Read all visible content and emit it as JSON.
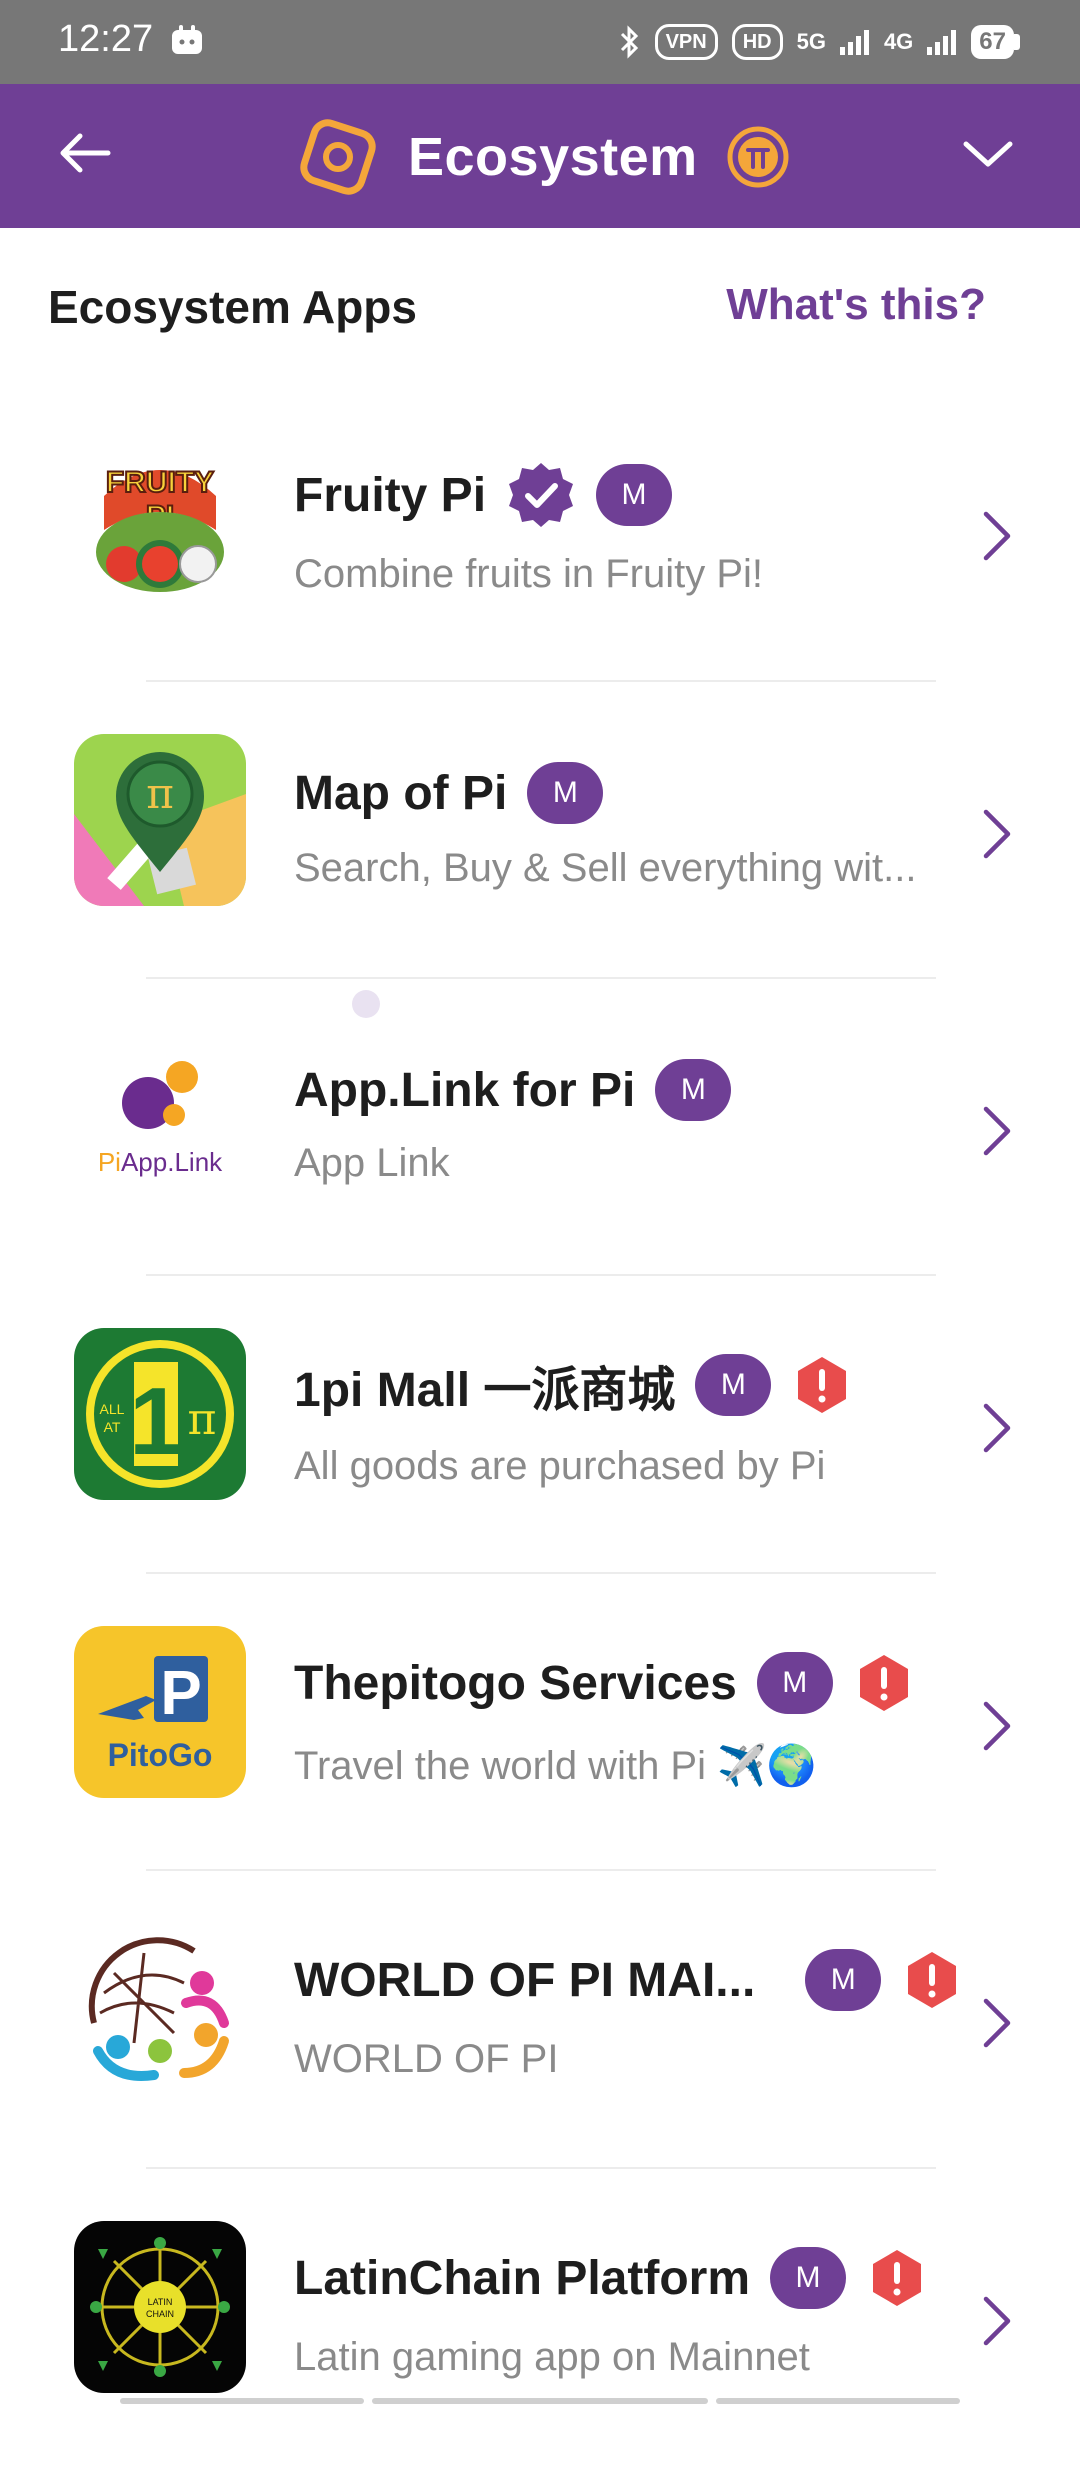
{
  "status": {
    "time": "12:27",
    "vpn": "VPN",
    "hd": "HD",
    "net1": "5G",
    "net2": "4G",
    "battery": "67"
  },
  "header": {
    "title": "Ecosystem",
    "accent": "#6f3f95"
  },
  "section": {
    "title": "Ecosystem Apps",
    "link": "What's this?"
  },
  "badge_label": "M",
  "apps": [
    {
      "name": "Fruity Pi",
      "desc": "Combine fruits in Fruity Pi!",
      "verified": true,
      "alert": false,
      "icon_text": "FRUITY PI"
    },
    {
      "name": "Map of Pi",
      "desc": "Search, Buy & Sell everything wit...",
      "verified": false,
      "alert": false
    },
    {
      "name": "App.Link for Pi",
      "desc": "App Link",
      "verified": false,
      "alert": false,
      "icon_text_pi": "Pi",
      "icon_text_link": "App.Link"
    },
    {
      "name": "1pi Mall 一派商城",
      "desc": "All goods are purchased by Pi",
      "verified": false,
      "alert": true,
      "icon_text_small": "ALL AT",
      "icon_text_big": "1"
    },
    {
      "name": "Thepitogo Services",
      "desc": "Travel the world with Pi ✈️🌍",
      "verified": false,
      "alert": true,
      "icon_text": "PitoGo"
    },
    {
      "name": "WORLD OF PI MAI...",
      "desc": "WORLD OF PI",
      "verified": false,
      "alert": true
    },
    {
      "name": "LatinChain Platform",
      "desc": "Latin gaming app on Mainnet",
      "verified": false,
      "alert": true,
      "icon_text": "LATIN CHAIN"
    }
  ]
}
